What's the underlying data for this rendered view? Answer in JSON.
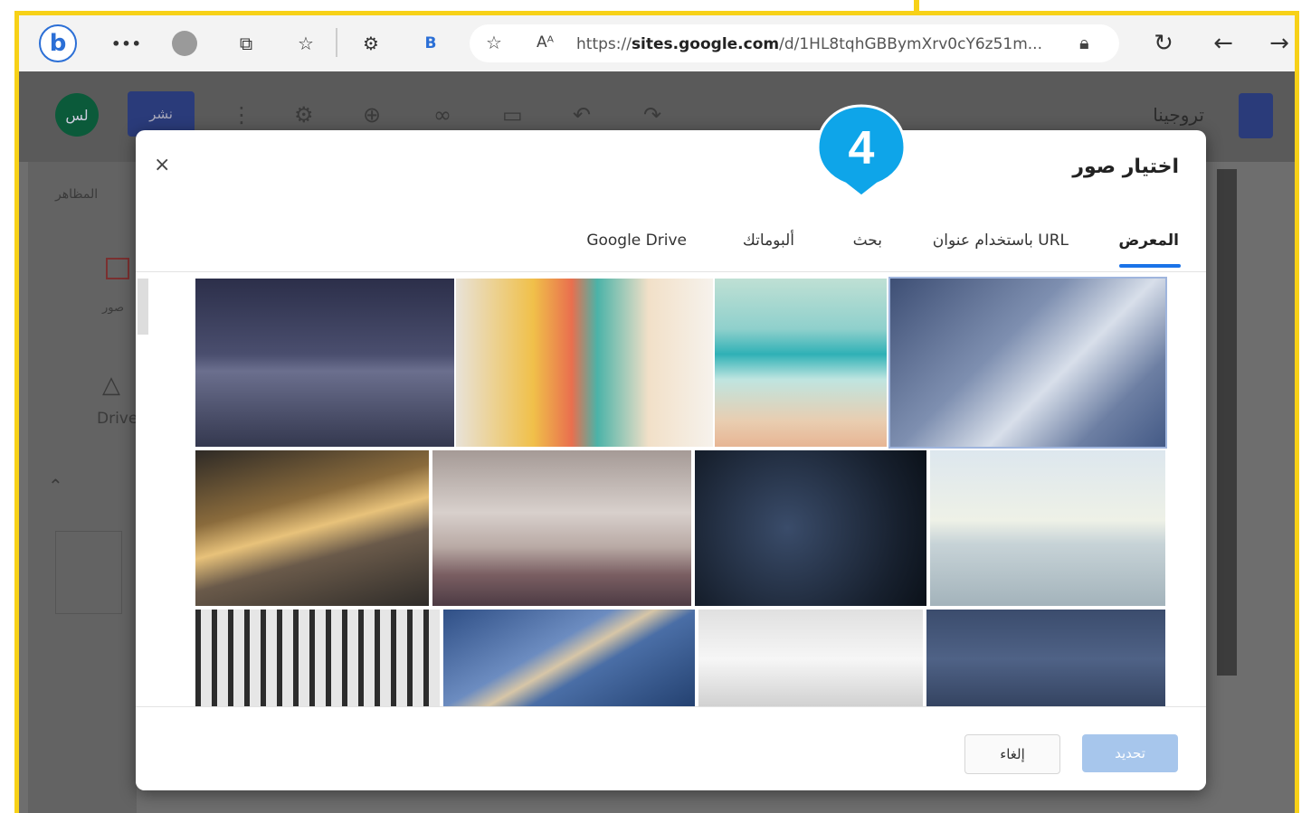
{
  "browser": {
    "url_prefix": "https://",
    "url_domain": "sites.google.com",
    "url_path": "/d/1HL8tqhGBBymXrv0cY6z51m...",
    "letter_b": "B",
    "read_aloud": "Aᴬ",
    "more": "•••"
  },
  "site_editor": {
    "site_name": "تروجينا",
    "publish_label": "نشر",
    "user_initials": "لس",
    "panel_themes": "المظاهر",
    "panel_images": "صور",
    "panel_drive": "Drive"
  },
  "modal": {
    "title": "اختيار صور",
    "close": "×",
    "tabs": [
      "المعرض",
      "باستخدام عنوان URL",
      "بحث",
      "ألبوماتك",
      "Google Drive"
    ],
    "active_tab": "المعرض",
    "cancel_label": "إلغاء",
    "select_label": "تحديد"
  },
  "step_badge": "4",
  "colors": {
    "frame": "#f7d117",
    "accent": "#1a73e8",
    "badge": "#0ea5e9"
  }
}
